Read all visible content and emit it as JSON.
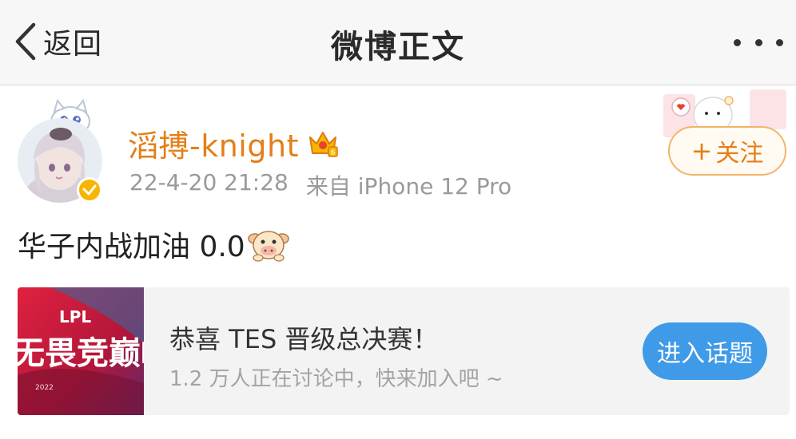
{
  "navbar": {
    "back_label": "返回",
    "title": "微博正文",
    "more_icon": "more-dots-icon"
  },
  "post": {
    "author": {
      "name": "滔搏-knight",
      "avatar_icon": "anime-avatar",
      "verified_icon": "verified-badge-icon",
      "vip_icon": "vip-crown-icon"
    },
    "time": "22-4-20 21:28",
    "source": "来自 iPhone 12 Pro",
    "follow_label": "关注",
    "text": "华子内战加油 0.0",
    "emoji_icon": "cow-emoji-icon"
  },
  "topic": {
    "title": "恭喜 TES 晋级总决赛！",
    "subtitle": "1.2 万人正在讨论中，快来加入吧 ~",
    "button_label": "进入话题",
    "thumb": {
      "logo_text": "LPL",
      "big_text": "无畏竞巅峰",
      "year_text": "2022"
    }
  },
  "colors": {
    "username": "#e37f19",
    "topic_button": "#3f9ae8",
    "verified": "#f7b500",
    "thumb_bg": "#c21a3c"
  }
}
